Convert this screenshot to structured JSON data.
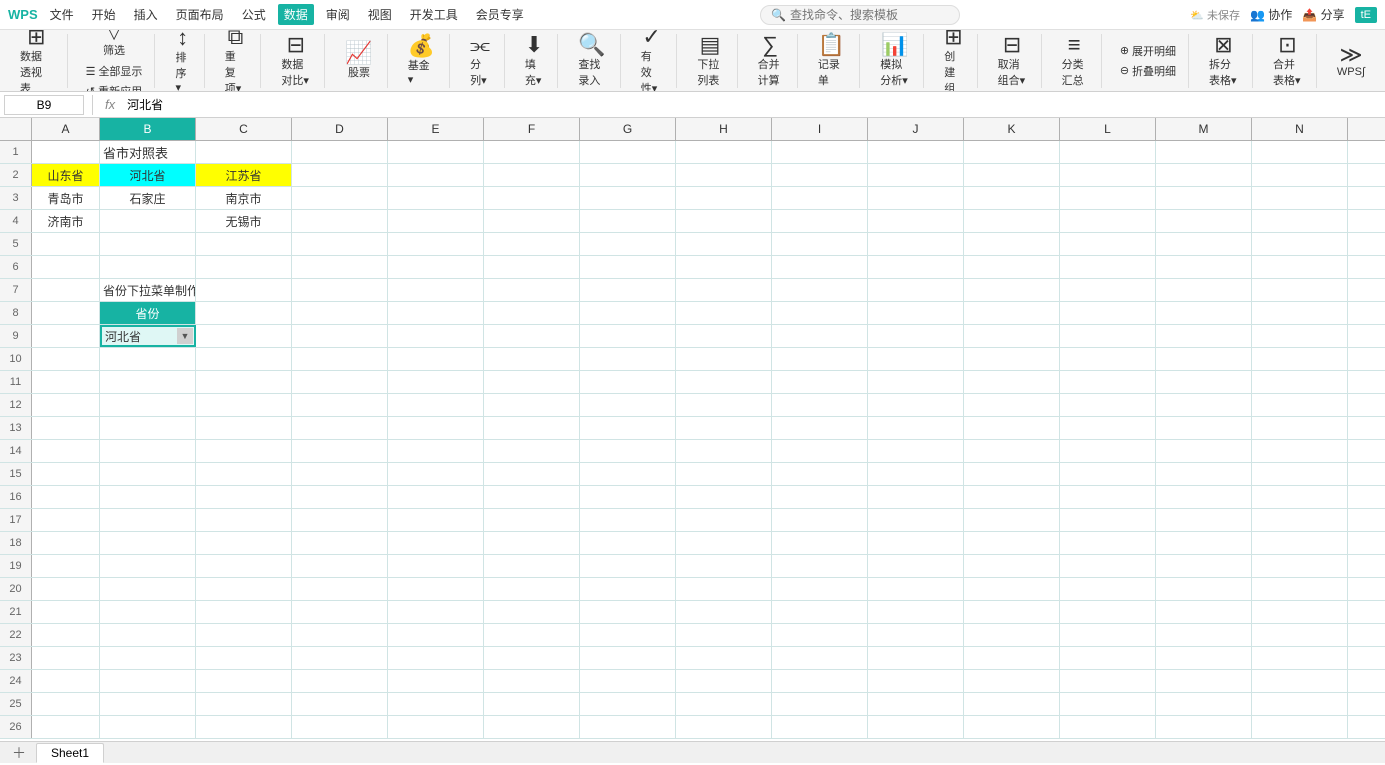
{
  "titlebar": {
    "menu_items": [
      "文件",
      "开始",
      "插入",
      "页面布局",
      "公式",
      "数据",
      "审阅",
      "视图",
      "开发工具",
      "会员专享"
    ],
    "data_tab": "数据",
    "search_placeholder": "查找命令、搜索模板",
    "right_items": [
      "未保存",
      "协作",
      "分享"
    ],
    "user_badge": "tE"
  },
  "ribbon": {
    "groups": [
      {
        "name": "数据透视表",
        "buttons": [
          {
            "label": "数据透视表",
            "icon": "⊞"
          }
        ]
      },
      {
        "name": "筛选",
        "buttons": [
          {
            "label": "筛选",
            "icon": "▽"
          },
          {
            "label": "全部显示",
            "icon": ""
          },
          {
            "label": "重新应用",
            "icon": ""
          }
        ]
      },
      {
        "name": "排序",
        "buttons": [
          {
            "label": "排序▾",
            "icon": "↕"
          }
        ]
      },
      {
        "name": "重复项",
        "buttons": [
          {
            "label": "重复项▾",
            "icon": "⧉"
          }
        ]
      },
      {
        "name": "数据对比",
        "buttons": [
          {
            "label": "数据对比▾",
            "icon": "⊟"
          }
        ]
      },
      {
        "name": "股票",
        "buttons": [
          {
            "label": "股票",
            "icon": "📈"
          }
        ]
      },
      {
        "name": "基金",
        "buttons": [
          {
            "label": "基金▾",
            "icon": "💰"
          }
        ]
      },
      {
        "name": "分列",
        "buttons": [
          {
            "label": "分列▾",
            "icon": "⫘"
          }
        ]
      },
      {
        "name": "填充",
        "buttons": [
          {
            "label": "填充▾",
            "icon": "⬇"
          }
        ]
      },
      {
        "name": "查找录入",
        "buttons": [
          {
            "label": "查找录入",
            "icon": "🔍"
          }
        ]
      },
      {
        "name": "有效性",
        "buttons": [
          {
            "label": "有效性▾",
            "icon": "✓"
          }
        ]
      },
      {
        "name": "下拉列表",
        "buttons": [
          {
            "label": "下拉列表",
            "icon": "▤"
          }
        ]
      },
      {
        "name": "合并计算",
        "buttons": [
          {
            "label": "合并计算",
            "icon": "∑"
          }
        ]
      },
      {
        "name": "记录单",
        "buttons": [
          {
            "label": "记录单",
            "icon": "📋"
          }
        ]
      },
      {
        "name": "模拟分析",
        "buttons": [
          {
            "label": "模拟分析▾",
            "icon": ""
          }
        ]
      },
      {
        "name": "创建组",
        "buttons": [
          {
            "label": "创建组",
            "icon": ""
          }
        ]
      },
      {
        "name": "取消组合",
        "buttons": [
          {
            "label": "取消组合▾",
            "icon": ""
          }
        ]
      },
      {
        "name": "分类汇总",
        "buttons": [
          {
            "label": "分类汇总",
            "icon": ""
          }
        ]
      },
      {
        "name": "展开明细",
        "buttons": [
          {
            "label": "展开明细",
            "icon": ""
          },
          {
            "label": "折叠明细",
            "icon": ""
          }
        ]
      },
      {
        "name": "拆分表格",
        "buttons": [
          {
            "label": "拆分表格▾",
            "icon": ""
          }
        ]
      },
      {
        "name": "合并表格",
        "buttons": [
          {
            "label": "合并表格▾",
            "icon": ""
          }
        ]
      },
      {
        "name": "WPS",
        "buttons": [
          {
            "label": "WPS∫",
            "icon": ""
          }
        ]
      }
    ]
  },
  "formula_bar": {
    "cell_ref": "B9",
    "formula_label": "fx",
    "formula_value": "河北省"
  },
  "columns": {
    "headers": [
      "",
      "A",
      "B",
      "C",
      "D",
      "E",
      "F",
      "G",
      "H",
      "I",
      "J",
      "K",
      "L",
      "M",
      "N"
    ]
  },
  "rows": [
    {
      "num": 1,
      "cells": {
        "a": "",
        "b": "省市对照表",
        "c": "",
        "d": ""
      }
    },
    {
      "num": 2,
      "cells": {
        "a": "山东省",
        "b": "河北省",
        "c": "江苏省",
        "d": ""
      }
    },
    {
      "num": 3,
      "cells": {
        "a": "青岛市",
        "b": "石家庄",
        "c": "南京市",
        "d": ""
      }
    },
    {
      "num": 4,
      "cells": {
        "a": "济南市",
        "b": "",
        "c": "无锡市",
        "d": ""
      }
    },
    {
      "num": 5,
      "cells": {
        "a": "",
        "b": "",
        "c": "",
        "d": ""
      }
    },
    {
      "num": 6,
      "cells": {
        "a": "",
        "b": "",
        "c": "",
        "d": ""
      }
    },
    {
      "num": 7,
      "cells": {
        "a": "",
        "b": "省份下拉菜单制作",
        "c": "",
        "d": ""
      }
    },
    {
      "num": 8,
      "cells": {
        "a": "",
        "b": "省份",
        "c": "",
        "d": ""
      }
    },
    {
      "num": 9,
      "cells": {
        "a": "",
        "b": "河北省",
        "c": "",
        "d": ""
      }
    },
    {
      "num": 10,
      "cells": {
        "a": "",
        "b": "",
        "c": "",
        "d": ""
      }
    },
    {
      "num": 11,
      "cells": {
        "a": "",
        "b": "",
        "c": "",
        "d": ""
      }
    },
    {
      "num": 12,
      "cells": {
        "a": "",
        "b": "",
        "c": "",
        "d": ""
      }
    },
    {
      "num": 13,
      "cells": {
        "a": "",
        "b": "",
        "c": "",
        "d": ""
      }
    },
    {
      "num": 14,
      "cells": {
        "a": "",
        "b": "",
        "c": "",
        "d": ""
      }
    },
    {
      "num": 15,
      "cells": {
        "a": "",
        "b": "",
        "c": "",
        "d": ""
      }
    },
    {
      "num": 16,
      "cells": {
        "a": "",
        "b": "",
        "c": "",
        "d": ""
      }
    },
    {
      "num": 17,
      "cells": {
        "a": "",
        "b": "",
        "c": "",
        "d": ""
      }
    },
    {
      "num": 18,
      "cells": {
        "a": "",
        "b": "",
        "c": "",
        "d": ""
      }
    },
    {
      "num": 19,
      "cells": {
        "a": "",
        "b": "",
        "c": "",
        "d": ""
      }
    },
    {
      "num": 20,
      "cells": {
        "a": "",
        "b": "",
        "c": "",
        "d": ""
      }
    },
    {
      "num": 21,
      "cells": {
        "a": "",
        "b": "",
        "c": "",
        "d": ""
      }
    },
    {
      "num": 22,
      "cells": {
        "a": "",
        "b": "",
        "c": "",
        "d": ""
      }
    },
    {
      "num": 23,
      "cells": {
        "a": "",
        "b": "",
        "c": "",
        "d": ""
      }
    },
    {
      "num": 24,
      "cells": {
        "a": "",
        "b": "",
        "c": "",
        "d": ""
      }
    },
    {
      "num": 25,
      "cells": {
        "a": "",
        "b": "",
        "c": "",
        "d": ""
      }
    },
    {
      "num": 26,
      "cells": {
        "a": "",
        "b": "",
        "c": "",
        "d": ""
      }
    }
  ],
  "sheet_tabs": [
    "Sheet1"
  ],
  "colors": {
    "accent": "#17b3a3",
    "yellow": "#ffff00",
    "cyan": "#00ffff",
    "header_bg": "#17b3a3",
    "grid_line": "#d0e4e4"
  }
}
